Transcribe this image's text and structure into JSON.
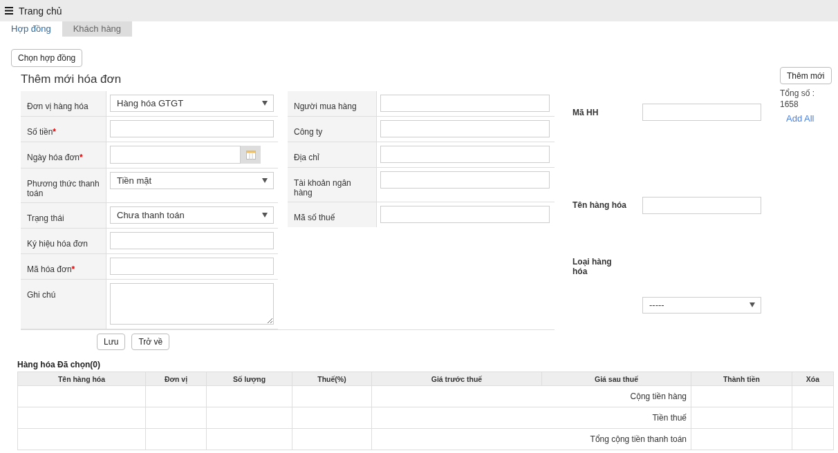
{
  "header": {
    "title": "Trang chủ"
  },
  "tabs": [
    {
      "label": "Hợp đồng",
      "selected": true
    },
    {
      "label": "Khách hàng",
      "selected": false
    }
  ],
  "choose_button": "Chọn hợp đồng",
  "form": {
    "title": "Thêm mới hóa đơn",
    "left_fields": [
      {
        "label": "Đơn vị hàng hóa",
        "kind": "select",
        "value": "Hàng hóa GTGT"
      },
      {
        "label": "Số tiền",
        "kind": "text",
        "required_mark": "*"
      },
      {
        "label": "Ngày hóa đơn",
        "kind": "date",
        "required_mark": "*"
      },
      {
        "label": "Phương thức thanh toán",
        "kind": "select",
        "value": "Tiền mặt"
      },
      {
        "label": "Trạng thái",
        "kind": "select",
        "value": "Chưa thanh toán"
      },
      {
        "label": "Ký hiệu hóa đơn",
        "kind": "text"
      },
      {
        "label": "Mã hóa đơn",
        "kind": "text",
        "required_mark": "*"
      },
      {
        "label": "Ghi chú",
        "kind": "textarea"
      }
    ],
    "right_fields": [
      {
        "label": "Người mua hàng",
        "kind": "text"
      },
      {
        "label": "Công ty",
        "kind": "text"
      },
      {
        "label": "Địa chỉ",
        "kind": "text"
      },
      {
        "label": "Tài khoản ngân hàng",
        "kind": "text"
      },
      {
        "label": "Mã số thuế",
        "kind": "text"
      }
    ],
    "buttons": [
      "Lưu",
      "Trở về"
    ]
  },
  "search": {
    "fields": [
      {
        "label": "Mã HH",
        "kind": "text"
      },
      {
        "label": "Tên hàng hóa",
        "kind": "text"
      },
      {
        "label": "Loại hàng hóa",
        "kind": "select",
        "value": "-----"
      }
    ],
    "add_button": "Thêm mới",
    "total": "Tổng số : 1658",
    "add_all_link": "Add All"
  },
  "selected_goods": {
    "title": "Hàng hóa Đã chọn(0)",
    "columns": [
      "Tên hàng hóa",
      "Đơn vị",
      "Số lượng",
      "Thuế(%)",
      "Giá trước thuế",
      "Giá sau thuế",
      "Thành tiền",
      "Xóa"
    ],
    "summary_rows": [
      "Cộng tiền hàng",
      "Tiền thuế",
      "Tổng cộng tiền thanh toán"
    ]
  }
}
